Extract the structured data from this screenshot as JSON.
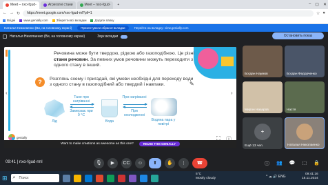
{
  "browser": {
    "tabs": [
      {
        "label": "Meet – nxo-fgud-",
        "color": "#ea4335"
      },
      {
        "label": "Агрегатні стани",
        "color": "#6b2fd9"
      },
      {
        "label": "Meet – nxo-fgud-",
        "color": "#34a853"
      }
    ],
    "url": "https://meet.google.com/nxo-fgud-ml?pli=1",
    "bookmarks": [
      "Вхідні",
      "www.genially.com",
      "Зберегти всі вкладки",
      "Додати папку"
    ],
    "tab_count": "…"
  },
  "sharebar": {
    "label": "Наталья Николаенко (Ви, на головному екрані)",
    "primary": "Презентувати обраної вкладки",
    "secondary": "Перейти на вкладку: view.genially.com"
  },
  "meet": {
    "presenter_label": "Наталья Николаенко (Ви, на головному екрані)",
    "sound_label": "Звук вкладки",
    "stop_button": "Остановить показ",
    "meeting_code": "nxo-fgud-rml",
    "time": "09:41",
    "participants": [
      {
        "name": "Богдан Наумов",
        "bg": "#6d5a4a"
      },
      {
        "name": "Богдан Федорченко",
        "bg": "#4a5568"
      },
      {
        "name": "Мирон Назаров",
        "bg": "#d1c1a8"
      },
      {
        "name": "Настя",
        "bg": "#5b6b4e"
      },
      {
        "name": "Ещё 13 чел.",
        "bg": "#3c4043"
      },
      {
        "name": "Наталья Николаенко",
        "bg": "#8a8179"
      }
    ]
  },
  "slide": {
    "para1": "Речовина може бути твердою, рідкою або газоподібною. Це різні",
    "para1_bold": "стани речовин",
    "para1_tail": ". За певних умов речовини можуть переходити з одного стану в інший.",
    "para2": "Розглянь схему і пригадай, які умови необхідні для переходу води з одного стану в газоподібний або твердий і навпаки.",
    "states": [
      "Лід",
      "Вода",
      "Водяна пара у повітрі"
    ],
    "arrows": {
      "melt": "Тане при нагріванні",
      "freeze": "Замерзає при 0 °С",
      "evaporate": "При нагріванні",
      "condense": "При охолодженні"
    },
    "logo": "genially"
  },
  "genially_bar": {
    "text": "Want to make creations as awesome as this one?",
    "button": "REUSE THIS GENIALLY"
  },
  "taskbar": {
    "search_placeholder": "Поиск",
    "weather_temp": "5°C",
    "weather_desc": "Mostly cloudy",
    "time": "09:41:16",
    "date": "18.11.2024"
  }
}
